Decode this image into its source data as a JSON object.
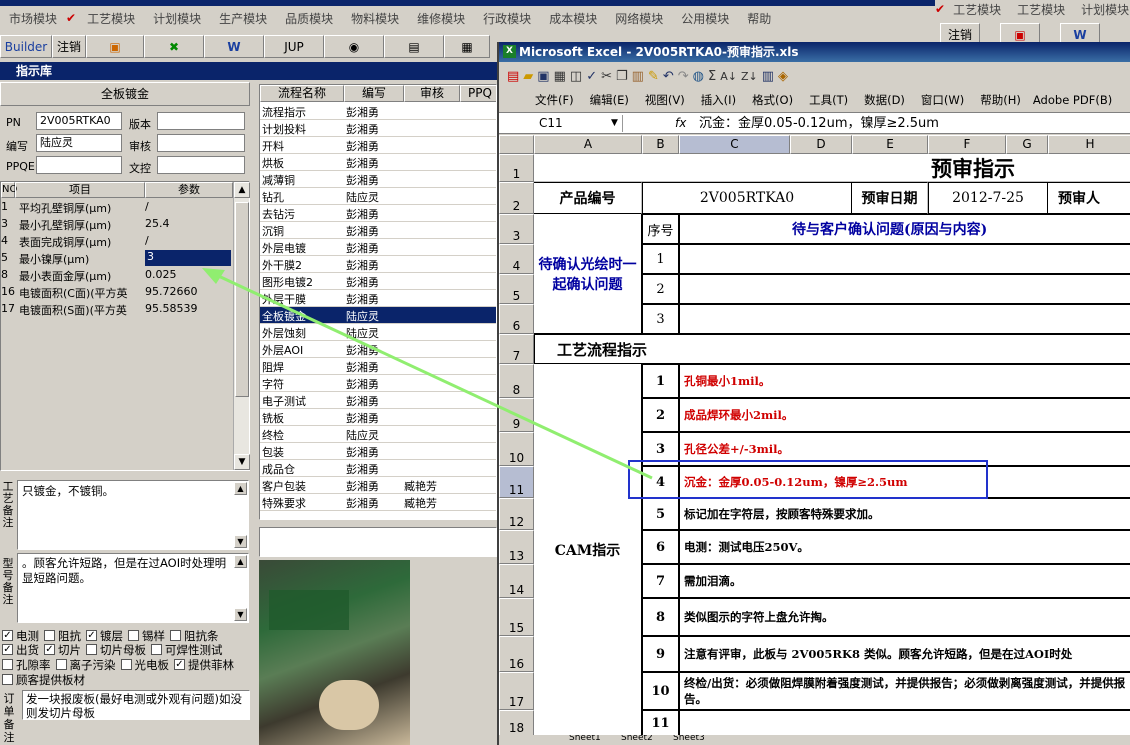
{
  "app": {
    "menu": [
      "市场模块",
      "工艺模块",
      "计划模块",
      "生产模块",
      "品质模块",
      "物料模块",
      "维修模块",
      "行政模块",
      "成本模块",
      "网络模块",
      "公用模块",
      "帮助"
    ],
    "right_menu": [
      "工艺模块",
      "工艺模块",
      "计划模块"
    ],
    "toolbar": [
      "Builder",
      "注销",
      "",
      "",
      "",
      "JUP",
      "",
      "",
      ""
    ],
    "right_toolbar": [
      "注销"
    ],
    "panel_title": "指示库"
  },
  "left": {
    "section_title": "全板镀金",
    "fields": {
      "pn_label": "PN",
      "pn_value": "2V005RTKA0",
      "version_label": "版本",
      "version_value": "",
      "author_label": "编写",
      "author_value": "陆应灵",
      "review_label": "审核",
      "review_value": "",
      "ppqe_label": "PPQE",
      "ppqe_value": "",
      "wenkong_label": "文控",
      "wenkong_value": ""
    },
    "param_headers": [
      "NO",
      "项目",
      "参数"
    ],
    "params": [
      {
        "no": "1",
        "item": "平均孔壁铜厚(μm)",
        "value": "/"
      },
      {
        "no": "3",
        "item": "最小孔壁铜厚(μm)",
        "value": "25.4"
      },
      {
        "no": "4",
        "item": "表面完成铜厚(μm)",
        "value": "/"
      },
      {
        "no": "5",
        "item": "最小镍厚(μm)",
        "value": "3"
      },
      {
        "no": "8",
        "item": "最小表面金厚(μm)",
        "value": "0.025"
      },
      {
        "no": "16",
        "item": "电镀面积(C面)(平方英",
        "value": "95.72660"
      },
      {
        "no": "17",
        "item": "电镀面积(S面)(平方英",
        "value": "95.58539"
      }
    ],
    "process_note_label": "工艺备注",
    "process_note": "只镀金，不镀铜。",
    "model_note_label": "型号备注",
    "model_note": "。顾客允许短路，但是在过AOI时处理明显短路问题。",
    "checkbox_rows": [
      [
        {
          "label": "电测",
          "checked": true
        },
        {
          "label": "阻抗",
          "checked": false
        },
        {
          "label": "镀层",
          "checked": true
        },
        {
          "label": "锡样",
          "checked": false
        },
        {
          "label": "阻抗条",
          "checked": false
        }
      ],
      [
        {
          "label": "出货",
          "checked": true
        },
        {
          "label": "切片",
          "checked": true
        },
        {
          "label": "切片母板",
          "checked": false
        },
        {
          "label": "可焊性测试",
          "checked": false
        }
      ],
      [
        {
          "label": "孔隙率",
          "checked": false
        },
        {
          "label": "离子污染",
          "checked": false
        },
        {
          "label": "光电板",
          "checked": false
        },
        {
          "label": "提供菲林",
          "checked": true
        }
      ],
      [
        {
          "label": "顾客提供板材",
          "checked": false
        }
      ]
    ],
    "order_note_label": "订单备注",
    "order_note": "发一块报废板(最好电测或外观有问题)如没则发切片母板"
  },
  "flow": {
    "headers": [
      "流程名称",
      "编写",
      "审核",
      "PPQ"
    ],
    "rows": [
      {
        "name": "流程指示",
        "author": "彭湘勇",
        "review": ""
      },
      {
        "name": "计划投料",
        "author": "彭湘勇",
        "review": ""
      },
      {
        "name": "开料",
        "author": "彭湘勇",
        "review": ""
      },
      {
        "name": "烘板",
        "author": "彭湘勇",
        "review": ""
      },
      {
        "name": "减薄铜",
        "author": "彭湘勇",
        "review": ""
      },
      {
        "name": "钻孔",
        "author": "陆应灵",
        "review": ""
      },
      {
        "name": "去钻污",
        "author": "彭湘勇",
        "review": ""
      },
      {
        "name": "沉铜",
        "author": "彭湘勇",
        "review": ""
      },
      {
        "name": "外层电镀",
        "author": "彭湘勇",
        "review": ""
      },
      {
        "name": "外干膜2",
        "author": "彭湘勇",
        "review": ""
      },
      {
        "name": "图形电镀2",
        "author": "彭湘勇",
        "review": ""
      },
      {
        "name": "外层干膜",
        "author": "彭湘勇",
        "review": ""
      },
      {
        "name": "全板镀金",
        "author": "陆应灵",
        "review": ""
      },
      {
        "name": "外层蚀刻",
        "author": "陆应灵",
        "review": ""
      },
      {
        "name": "外层AOI",
        "author": "彭湘勇",
        "review": ""
      },
      {
        "name": "阻焊",
        "author": "彭湘勇",
        "review": ""
      },
      {
        "name": "字符",
        "author": "彭湘勇",
        "review": ""
      },
      {
        "name": "电子测试",
        "author": "彭湘勇",
        "review": ""
      },
      {
        "name": "铣板",
        "author": "彭湘勇",
        "review": ""
      },
      {
        "name": "终检",
        "author": "陆应灵",
        "review": ""
      },
      {
        "name": "包装",
        "author": "彭湘勇",
        "review": ""
      },
      {
        "name": "成品仓",
        "author": "彭湘勇",
        "review": ""
      },
      {
        "name": "客户包装",
        "author": "彭湘勇",
        "review": "臧艳芳"
      },
      {
        "name": "特殊要求",
        "author": "彭湘勇",
        "review": "臧艳芳"
      }
    ],
    "selected_index": 12
  },
  "excel": {
    "title": "Microsoft Excel - 2V005RTKA0-预审指示.xls",
    "menu": [
      "文件(F)",
      "编辑(E)",
      "视图(V)",
      "插入(I)",
      "格式(O)",
      "工具(T)",
      "数据(D)",
      "窗口(W)",
      "帮助(H)",
      "Adobe PDF(B)"
    ],
    "name_box": "C11",
    "fx": "fx",
    "formula": "沉金：金厚0.05-0.12um，镍厚≥2.5um",
    "columns": [
      "A",
      "B",
      "C",
      "D",
      "E",
      "F",
      "G",
      "H"
    ],
    "title_cell": "预审指示",
    "product_label": "产品编号",
    "product_no": "2V005RTKA0",
    "review_date_label": "预审日期",
    "review_date": "2012-7-25",
    "reviewer_label": "预审人",
    "seq_label": "序号",
    "confirm_header": "待与客户确认问题(原因与内容)",
    "confirm_label": "待确认光绘时一起确认问题",
    "confirm_seq": [
      "1",
      "2",
      "3"
    ],
    "flow_label": "工艺流程指示",
    "cam_label": "CAM指示",
    "instructions": [
      {
        "seq": "1",
        "text": "孔铜最小1mil。",
        "red": true
      },
      {
        "seq": "2",
        "text": "成品焊环最小2mil。",
        "red": true
      },
      {
        "seq": "3",
        "text": "孔径公差+/-3mil。",
        "red": true
      },
      {
        "seq": "4",
        "text": "沉金：金厚0.05-0.12um，镍厚≥2.5um",
        "red": true
      },
      {
        "seq": "5",
        "text": "标记加在字符层，按顾客特殊要求加。",
        "red": false
      },
      {
        "seq": "6",
        "text": "电测：测试电压250V。",
        "red": false
      },
      {
        "seq": "7",
        "text": "需加泪滴。",
        "red": false
      },
      {
        "seq": "8",
        "text": "类似图示的字符上盘允许掏。",
        "red": false
      },
      {
        "seq": "9",
        "text": "注意有评审，此板与 2V005RK8 类似。顾客允许短路，但是在过AOI时处",
        "red": false
      },
      {
        "seq": "10",
        "text": "终检/出货：必须做阻焊膜附着强度测试，并提供报告；必须做剥离强度测试，并提供报告。",
        "red": false
      },
      {
        "seq": "11",
        "text": "",
        "red": false
      }
    ],
    "row_numbers": [
      "1",
      "2",
      "3",
      "4",
      "5",
      "6",
      "7",
      "8",
      "9",
      "10",
      "11",
      "12",
      "13",
      "14",
      "15",
      "16",
      "17",
      "18"
    ],
    "sheet_tabs": [
      "Sheet1",
      "Sheet2",
      "Sheet3"
    ]
  },
  "colors": {
    "selection": "#0a246a",
    "annotation_arrow": "#90ee70",
    "highlight_box": "#2233cc",
    "red_text": "#d00000"
  }
}
